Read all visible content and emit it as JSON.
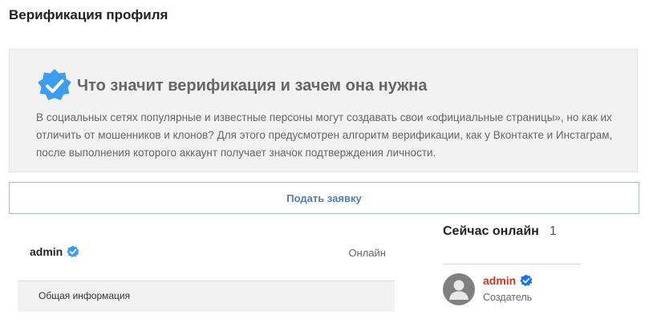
{
  "page": {
    "title": "Верификация профиля"
  },
  "info": {
    "title": "Что значит верификация и зачем она нужна",
    "text": "В социальных сетях популярные и известные персоны могут создавать свои «официальные страницы», но как их отличить от мошенников и клонов? Для этого предусмотрен алгоритм верификации, как у Вконтакте и Инстаграм, после выполнения которого аккаунт получает значок подтверждения личности.",
    "badge_icon": "verified-badge-icon"
  },
  "apply_button": {
    "label": "Подать заявку"
  },
  "profile": {
    "name": "admin",
    "status": "Онлайн",
    "section_label": "Общая информация"
  },
  "online_widget": {
    "title": "Сейчас онлайн",
    "count": "1",
    "users": [
      {
        "name": "admin",
        "role": "Создатель"
      }
    ]
  },
  "colors": {
    "badge": "#3b9cf0",
    "link": "#4f7fb5",
    "username": "#c0392b"
  }
}
